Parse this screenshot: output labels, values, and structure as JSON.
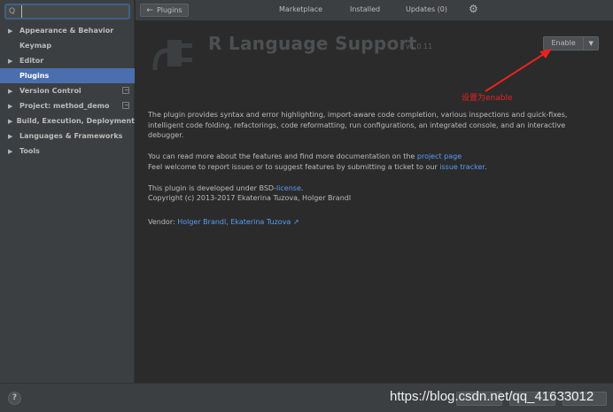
{
  "search": {
    "placeholder": "",
    "value": ""
  },
  "sidebar": {
    "items": [
      {
        "label": "Appearance & Behavior",
        "arrow": "▶"
      },
      {
        "label": "Keymap",
        "arrow": ""
      },
      {
        "label": "Editor",
        "arrow": "▶"
      },
      {
        "label": "Plugins",
        "arrow": "",
        "selected": true
      },
      {
        "label": "Version Control",
        "arrow": "▶",
        "project_icon": true
      },
      {
        "label": "Project: method_demo",
        "arrow": "▶",
        "project_icon": true
      },
      {
        "label": "Build, Execution, Deployment",
        "arrow": "▶"
      },
      {
        "label": "Languages & Frameworks",
        "arrow": "▶"
      },
      {
        "label": "Tools",
        "arrow": "▶"
      }
    ]
  },
  "topbar": {
    "back_label": "Plugins",
    "tabs": [
      "Marketplace",
      "Installed",
      "Updates (0)"
    ]
  },
  "plugin": {
    "title": "R Language Support",
    "version": "v1.0.11",
    "enable_label": "Enable",
    "annotation": "设置为enable",
    "description_1": "The plugin provides syntax and error highlighting, import-aware code completion, various inspections and quick-fixes, intelligent code folding, refactorings, code reformatting, run configurations, an integrated console, and an interactive debugger.",
    "description_2_pre": "You can read more about the features and find more documentation on the ",
    "description_2_link": "project page",
    "description_3_pre": "Feel welcome to report issues or to suggest features by submitting a ticket to our ",
    "description_3_link": "issue tracker",
    "description_3_post": ".",
    "license_pre": "This plugin is developed under BSD-",
    "license_link": "license",
    "license_post": ".",
    "copyright": "Copyright (c) 2013-2017 Ekaterina Tuzova, Holger Brandl",
    "vendor_label": "Vendor:",
    "vendor_link": "Holger Brandl, Ekaterina Tuzova ↗"
  },
  "bottom": {
    "help": "?",
    "watermark": "https://blog.csdn.net/qq_41633012"
  },
  "colors": {
    "selected": "#4b6eaf",
    "link": "#589df6",
    "annotation": "#e8231f"
  }
}
